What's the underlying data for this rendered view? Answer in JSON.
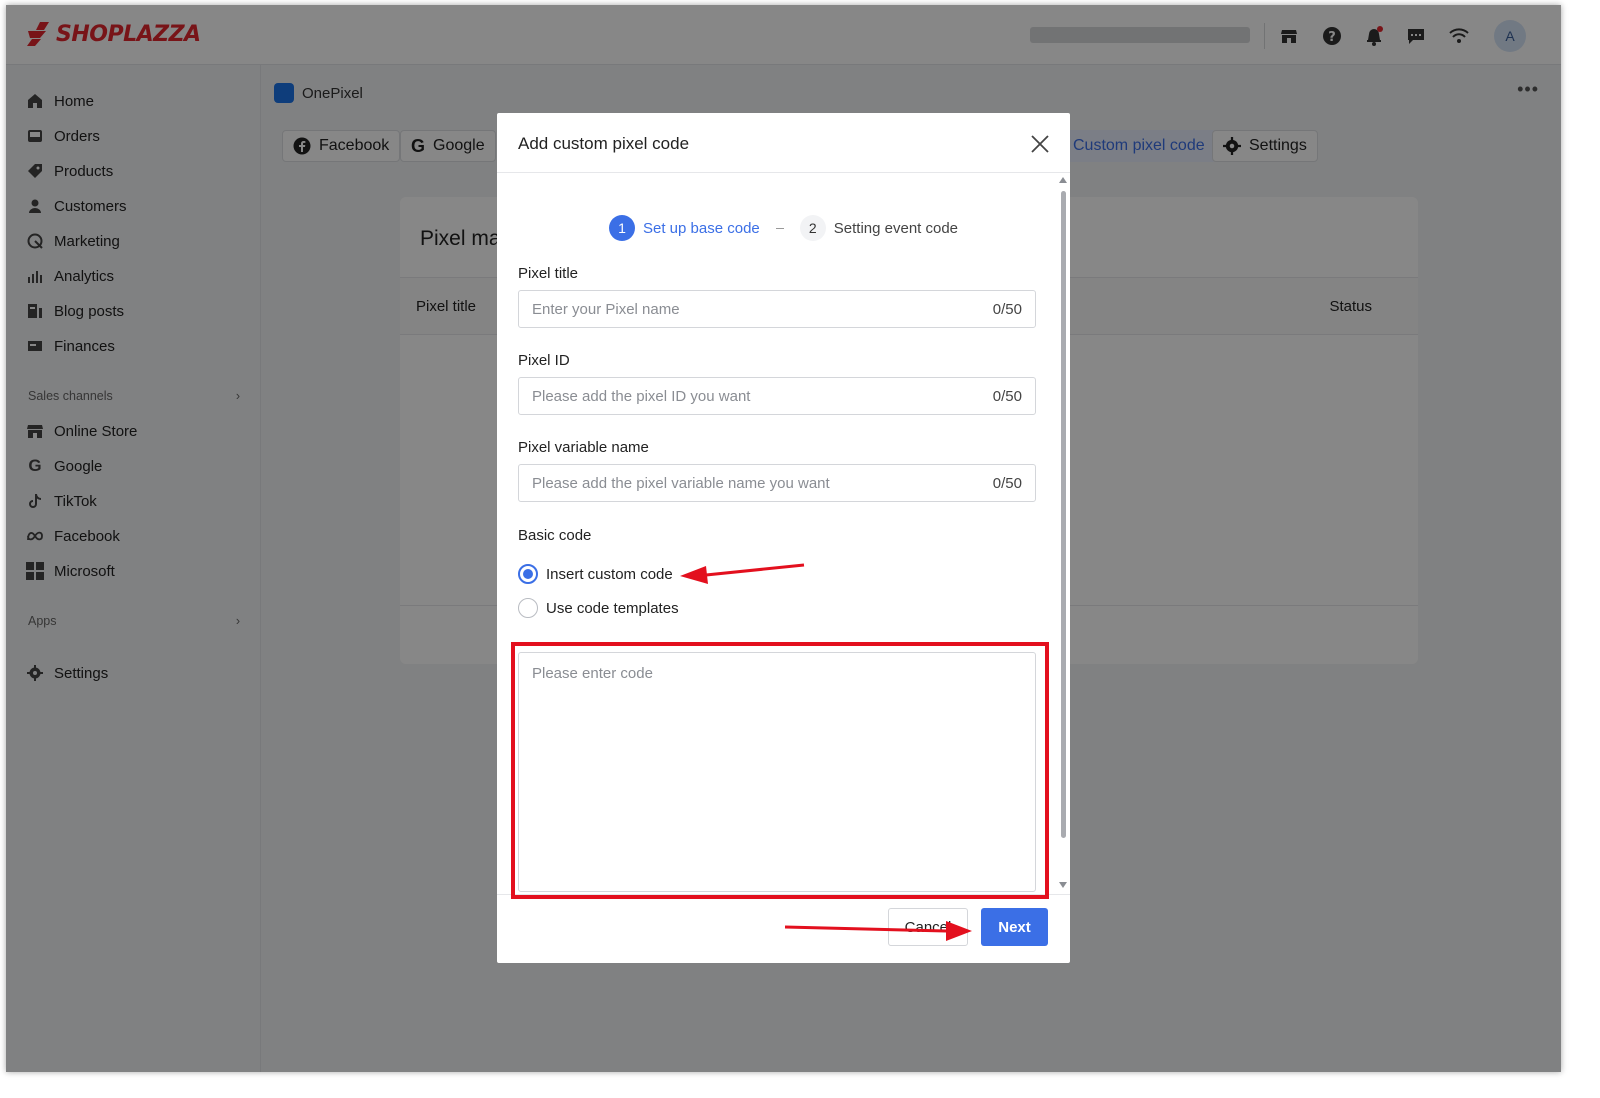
{
  "brand": {
    "name": "SHOPLAZZA",
    "color": "#e3262e"
  },
  "topbar": {
    "icons": [
      "store-icon",
      "help-icon",
      "bell-icon",
      "chat-icon",
      "wifi-icon"
    ],
    "avatar_letter": "A"
  },
  "sidebar": {
    "items": [
      {
        "label": "Home",
        "icon": "home-icon"
      },
      {
        "label": "Orders",
        "icon": "orders-icon"
      },
      {
        "label": "Products",
        "icon": "tag-icon"
      },
      {
        "label": "Customers",
        "icon": "person-icon"
      },
      {
        "label": "Marketing",
        "icon": "marketing-icon"
      },
      {
        "label": "Analytics",
        "icon": "analytics-icon"
      },
      {
        "label": "Blog posts",
        "icon": "blog-icon"
      },
      {
        "label": "Finances",
        "icon": "finances-icon"
      }
    ],
    "sales_channels_label": "Sales channels",
    "channels": [
      {
        "label": "Online Store",
        "icon": "store-icon"
      },
      {
        "label": "Google",
        "icon": "google-icon"
      },
      {
        "label": "TikTok",
        "icon": "tiktok-icon"
      },
      {
        "label": "Facebook",
        "icon": "meta-icon"
      },
      {
        "label": "Microsoft",
        "icon": "microsoft-icon"
      }
    ],
    "apps_label": "Apps",
    "settings_label": "Settings"
  },
  "main": {
    "app_title": "OnePixel",
    "tabs": [
      {
        "label": "Facebook"
      },
      {
        "label": "Google"
      },
      {
        "label": "Custom pixel code"
      },
      {
        "label": "Settings"
      }
    ],
    "card_title": "Pixel ma",
    "columns": {
      "pixel_title": "Pixel title",
      "status": "Status"
    }
  },
  "modal": {
    "title": "Add custom pixel code",
    "steps": [
      {
        "num": "1",
        "label": "Set up base code",
        "active": true
      },
      {
        "num": "2",
        "label": "Setting event code",
        "active": false
      }
    ],
    "fields": [
      {
        "label": "Pixel title",
        "placeholder": "Enter your Pixel name",
        "counter": "0/50"
      },
      {
        "label": "Pixel ID",
        "placeholder": "Please add the pixel ID you want",
        "counter": "0/50"
      },
      {
        "label": "Pixel variable name",
        "placeholder": "Please add the pixel variable name you want",
        "counter": "0/50"
      }
    ],
    "basic_code_label": "Basic code",
    "radio_options": [
      {
        "label": "Insert custom code",
        "selected": true
      },
      {
        "label": "Use code templates",
        "selected": false
      }
    ],
    "code_placeholder": "Please enter code",
    "cancel_label": "Cancel",
    "next_label": "Next"
  },
  "colors": {
    "accent": "#3b6fe6",
    "annotation": "#e3101e"
  }
}
